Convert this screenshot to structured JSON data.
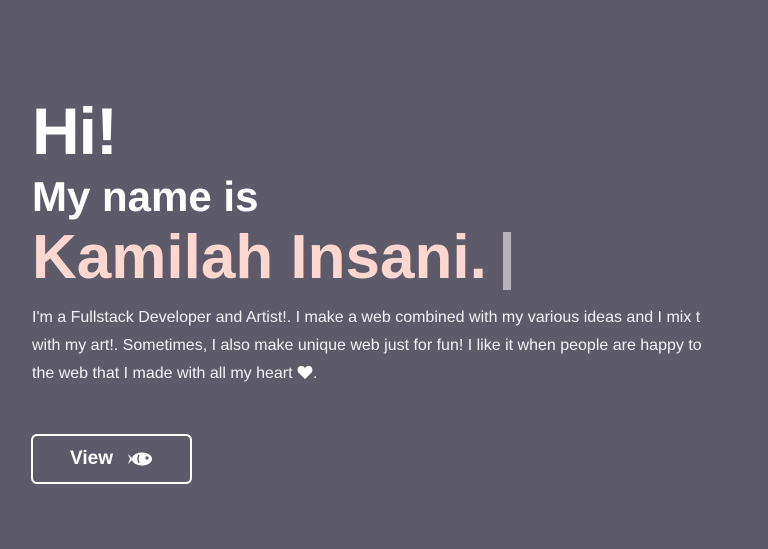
{
  "hero": {
    "greeting": "Hi!",
    "intro": "My name is",
    "name": "Kamilah Insani.",
    "description_lines": [
      "I'm a Fullstack Developer and Artist!. I make a web combined with my various ideas and I mix t",
      "with my art!. Sometimes, I also make unique web just for fun! I like it when people are happy to",
      "the web that I made with all my heart",
      "."
    ]
  },
  "button": {
    "label": "View",
    "icon": "fish-icon"
  },
  "colors": {
    "background": "#5d5b6a",
    "name_accent": "#ffd7d0",
    "cursor": "#b6b3bf",
    "text": "#ffffff"
  }
}
